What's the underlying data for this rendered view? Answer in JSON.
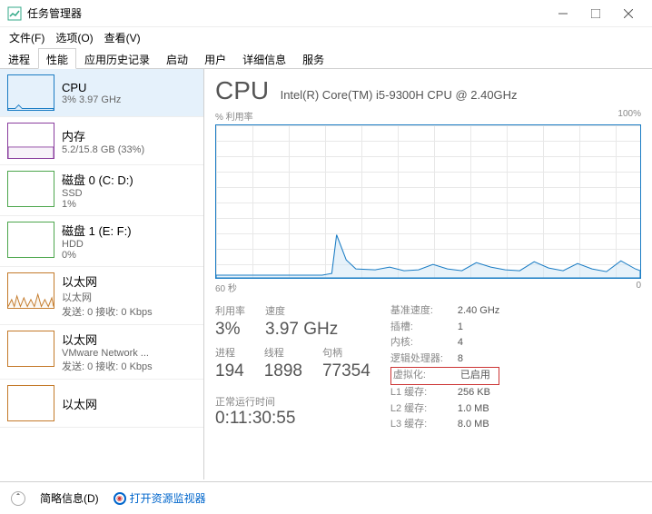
{
  "window": {
    "title": "任务管理器",
    "min": "—",
    "max": "□",
    "close": "✕"
  },
  "menu": {
    "file": "文件(F)",
    "options": "选项(O)",
    "view": "查看(V)"
  },
  "tabs": {
    "processes": "进程",
    "performance": "性能",
    "history": "应用历史记录",
    "startup": "启动",
    "users": "用户",
    "details": "详细信息",
    "services": "服务"
  },
  "sidebar": [
    {
      "name": "CPU",
      "sub": "3%  3.97 GHz",
      "type": "cpu"
    },
    {
      "name": "内存",
      "sub": "5.2/15.8 GB (33%)",
      "type": "mem"
    },
    {
      "name": "磁盘 0 (C: D:)",
      "sub": "SSD",
      "sub2": "1%",
      "type": "disk"
    },
    {
      "name": "磁盘 1 (E: F:)",
      "sub": "HDD",
      "sub2": "0%",
      "type": "disk"
    },
    {
      "name": "以太网",
      "sub": "以太网",
      "sub2": "发送: 0 接收: 0 Kbps",
      "type": "eth"
    },
    {
      "name": "以太网",
      "sub": "VMware Network ...",
      "sub2": "发送: 0 接收: 0 Kbps",
      "type": "eth"
    },
    {
      "name": "以太网",
      "sub": "",
      "type": "eth"
    }
  ],
  "cpu": {
    "title": "CPU",
    "model": "Intel(R) Core(TM) i5-9300H CPU @ 2.40GHz",
    "util_label": "% 利用率",
    "util_max": "100%",
    "x_left": "60 秒",
    "x_right": "0"
  },
  "stats": {
    "util_lbl": "利用率",
    "util": "3%",
    "speed_lbl": "速度",
    "speed": "3.97 GHz",
    "proc_lbl": "进程",
    "proc": "194",
    "thread_lbl": "线程",
    "thread": "1898",
    "handle_lbl": "句柄",
    "handle": "77354",
    "uptime_lbl": "正常运行时间",
    "uptime": "0:11:30:55"
  },
  "details": {
    "base_lbl": "基准速度:",
    "base": "2.40 GHz",
    "socket_lbl": "插槽:",
    "socket": "1",
    "core_lbl": "内核:",
    "core": "4",
    "logical_lbl": "逻辑处理器:",
    "logical": "8",
    "virt_lbl": "虚拟化:",
    "virt": "已启用",
    "l1_lbl": "L1 缓存:",
    "l1": "256 KB",
    "l2_lbl": "L2 缓存:",
    "l2": "1.0 MB",
    "l3_lbl": "L3 缓存:",
    "l3": "8.0 MB"
  },
  "footer": {
    "fewer": "简略信息(D)",
    "resmon": "打开资源监视器"
  },
  "chart_data": {
    "type": "area",
    "title": "% 利用率",
    "xlabel": "60 秒 → 0",
    "ylabel": "%",
    "ylim": [
      0,
      100
    ],
    "x": [
      0,
      2,
      4,
      6,
      8,
      10,
      12,
      14,
      16,
      18,
      20,
      22,
      24,
      26,
      28,
      30,
      32,
      34,
      36,
      38,
      40,
      42,
      44,
      46,
      48,
      50,
      52,
      54,
      56,
      58,
      60
    ],
    "values": [
      2,
      2,
      2,
      2,
      2,
      2,
      2,
      2,
      2,
      2,
      2,
      2,
      3,
      28,
      12,
      6,
      5,
      5,
      7,
      6,
      5,
      9,
      7,
      5,
      10,
      8,
      6,
      5,
      11,
      7,
      5
    ]
  }
}
